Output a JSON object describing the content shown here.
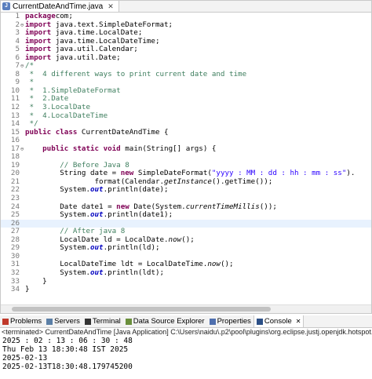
{
  "editor": {
    "tab_title": "CurrentDateAndTime.java",
    "lines": [
      {
        "num": "1",
        "marker": "",
        "hl": false,
        "tokens": [
          [
            "kw",
            "package"
          ],
          [
            "",
            "com;"
          ]
        ]
      },
      {
        "num": "2",
        "marker": "⊖",
        "hl": false,
        "tokens": [
          [
            "kw",
            "import"
          ],
          [
            "",
            " java.text.SimpleDateFormat;"
          ]
        ]
      },
      {
        "num": "3",
        "marker": "",
        "hl": false,
        "tokens": [
          [
            "kw",
            "import"
          ],
          [
            "",
            " java.time.LocalDate;"
          ]
        ]
      },
      {
        "num": "4",
        "marker": "",
        "hl": false,
        "tokens": [
          [
            "kw",
            "import"
          ],
          [
            "",
            " java.time.LocalDateTime;"
          ]
        ]
      },
      {
        "num": "5",
        "marker": "",
        "hl": false,
        "tokens": [
          [
            "kw",
            "import"
          ],
          [
            "",
            " java.util.Calendar;"
          ]
        ]
      },
      {
        "num": "6",
        "marker": "",
        "hl": false,
        "tokens": [
          [
            "kw",
            "import"
          ],
          [
            "",
            " java.util.Date;"
          ]
        ]
      },
      {
        "num": "7",
        "marker": "⊖",
        "hl": false,
        "tokens": [
          [
            "cm",
            "/*"
          ]
        ]
      },
      {
        "num": "8",
        "marker": "",
        "hl": false,
        "tokens": [
          [
            "cm",
            " *  4 different ways to print current date and time"
          ]
        ]
      },
      {
        "num": "9",
        "marker": "",
        "hl": false,
        "tokens": [
          [
            "cm",
            " *"
          ]
        ]
      },
      {
        "num": "10",
        "marker": "",
        "hl": false,
        "tokens": [
          [
            "cm",
            " *  1.SimpleDateFormat"
          ]
        ]
      },
      {
        "num": "11",
        "marker": "",
        "hl": false,
        "tokens": [
          [
            "cm",
            " *  2.Date"
          ]
        ]
      },
      {
        "num": "12",
        "marker": "",
        "hl": false,
        "tokens": [
          [
            "cm",
            " *  3.LocalDate"
          ]
        ]
      },
      {
        "num": "13",
        "marker": "",
        "hl": false,
        "tokens": [
          [
            "cm",
            " *  4.LocalDateTime"
          ]
        ]
      },
      {
        "num": "14",
        "marker": "",
        "hl": false,
        "tokens": [
          [
            "cm",
            " */"
          ]
        ]
      },
      {
        "num": "15",
        "marker": "",
        "hl": false,
        "tokens": [
          [
            "kw",
            "public class"
          ],
          [
            "",
            " CurrentDateAndTime {"
          ]
        ]
      },
      {
        "num": "16",
        "marker": "",
        "hl": false,
        "tokens": []
      },
      {
        "num": "17",
        "marker": "⊖",
        "hl": false,
        "tokens": [
          [
            "",
            "    "
          ],
          [
            "kw",
            "public static void"
          ],
          [
            "",
            " main(String[] args) {"
          ]
        ]
      },
      {
        "num": "18",
        "marker": "",
        "hl": false,
        "tokens": []
      },
      {
        "num": "19",
        "marker": "",
        "hl": false,
        "tokens": [
          [
            "cm",
            "        // Before Java 8"
          ]
        ]
      },
      {
        "num": "20",
        "marker": "",
        "hl": false,
        "tokens": [
          [
            "",
            "        String date = "
          ],
          [
            "kw",
            "new"
          ],
          [
            "",
            " SimpleDateFormat("
          ],
          [
            "st",
            "\"yyyy : MM : dd : hh : mm : ss\""
          ],
          [
            "",
            ")."
          ]
        ]
      },
      {
        "num": "21",
        "marker": "",
        "hl": false,
        "tokens": [
          [
            "",
            "                format(Calendar."
          ],
          [
            "it",
            "getInstance"
          ],
          [
            "",
            "().getTime());"
          ]
        ]
      },
      {
        "num": "22",
        "marker": "",
        "hl": false,
        "tokens": [
          [
            "",
            "        System."
          ],
          [
            "fd it",
            "out"
          ],
          [
            "",
            ".println(date);"
          ]
        ]
      },
      {
        "num": "23",
        "marker": "",
        "hl": false,
        "tokens": []
      },
      {
        "num": "24",
        "marker": "",
        "hl": false,
        "tokens": [
          [
            "",
            "        Date date1 = "
          ],
          [
            "kw",
            "new"
          ],
          [
            "",
            " Date(System."
          ],
          [
            "it",
            "currentTimeMillis"
          ],
          [
            "",
            "());"
          ]
        ]
      },
      {
        "num": "25",
        "marker": "",
        "hl": false,
        "tokens": [
          [
            "",
            "        System."
          ],
          [
            "fd it",
            "out"
          ],
          [
            "",
            ".println(date1);"
          ]
        ]
      },
      {
        "num": "26",
        "marker": "",
        "hl": true,
        "tokens": []
      },
      {
        "num": "27",
        "marker": "",
        "hl": false,
        "tokens": [
          [
            "cm",
            "        // After java 8"
          ]
        ]
      },
      {
        "num": "28",
        "marker": "",
        "hl": false,
        "tokens": [
          [
            "",
            "        LocalDate ld = LocalDate."
          ],
          [
            "it",
            "now"
          ],
          [
            "",
            "();"
          ]
        ]
      },
      {
        "num": "29",
        "marker": "",
        "hl": false,
        "tokens": [
          [
            "",
            "        System."
          ],
          [
            "fd it",
            "out"
          ],
          [
            "",
            ".println(ld);"
          ]
        ]
      },
      {
        "num": "30",
        "marker": "",
        "hl": false,
        "tokens": []
      },
      {
        "num": "31",
        "marker": "",
        "hl": false,
        "tokens": [
          [
            "",
            "        LocalDateTime ldt = LocalDateTime."
          ],
          [
            "it",
            "now"
          ],
          [
            "",
            "();"
          ]
        ]
      },
      {
        "num": "32",
        "marker": "",
        "hl": false,
        "tokens": [
          [
            "",
            "        System."
          ],
          [
            "fd it",
            "out"
          ],
          [
            "",
            ".println(ldt);"
          ]
        ]
      },
      {
        "num": "33",
        "marker": "",
        "hl": false,
        "tokens": [
          [
            "",
            "    }"
          ]
        ]
      },
      {
        "num": "34",
        "marker": "",
        "hl": false,
        "tokens": [
          [
            "",
            "}"
          ]
        ]
      }
    ]
  },
  "views": [
    {
      "label": "Problems",
      "icon": "problems-icon",
      "color": "#c0392b",
      "active": false
    },
    {
      "label": "Servers",
      "icon": "servers-icon",
      "color": "#5b7fa6",
      "active": false
    },
    {
      "label": "Terminal",
      "icon": "terminal-icon",
      "color": "#333333",
      "active": false
    },
    {
      "label": "Data Source Explorer",
      "icon": "data-source-icon",
      "color": "#6a8f3c",
      "active": false
    },
    {
      "label": "Properties",
      "icon": "properties-icon",
      "color": "#4f6fae",
      "active": false
    },
    {
      "label": "Console",
      "icon": "console-icon",
      "color": "#2c4f86",
      "active": true
    }
  ],
  "console": {
    "status": "<terminated> CurrentDateAndTime [Java Application] C:\\Users\\naidu\\.p2\\pool\\plugins\\org.eclipse.justj.openjdk.hotspot.jre.full.w",
    "lines": [
      "2025 : 02 : 13 : 06 : 30 : 48",
      "Thu Feb 13 18:30:48 IST 2025",
      "2025-02-13",
      "2025-02-13T18:30:48.179745200"
    ]
  }
}
